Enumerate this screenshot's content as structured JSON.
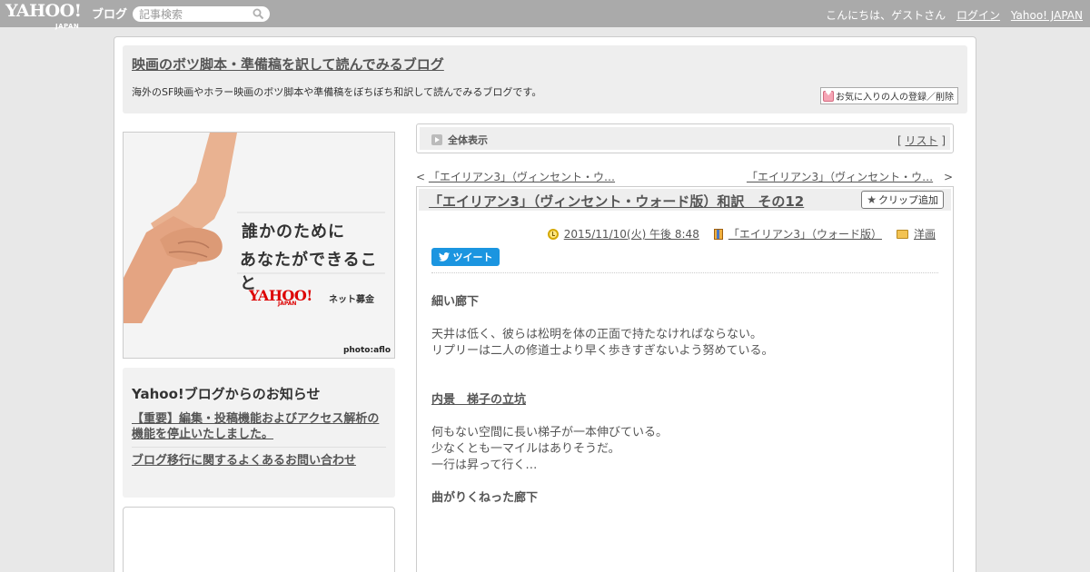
{
  "topbar": {
    "logo": "YAHOO!",
    "logo_sub": "JAPAN",
    "logo_blog": "ブログ",
    "search_placeholder": "記事検索",
    "greeting": "こんにちは、ゲストさん",
    "login": "ログイン",
    "yahoo_japan": "Yahoo! JAPAN"
  },
  "header": {
    "title": "映画のボツ脚本・準備稿を訳して読んでみるブログ",
    "description": "海外のSF映画やホラー映画のボツ脚本や準備稿をぼちぼち和訳して読んでみるブログです。",
    "fav_button": "お気に入りの人の登録／削除"
  },
  "banner": {
    "line1": "誰かのために",
    "line2": "あなたができること",
    "brand": "YAHOO!",
    "brand_sub": "JAPAN",
    "bokin": "ネット募金",
    "credit": "photo:aflo"
  },
  "notice": {
    "title": "Yahoo!ブログからのお知らせ",
    "links": [
      "【重要】編集・投稿機能およびアクセス解析の機能を停止いたしました。",
      "ブログ移行に関するよくあるお問い合わせ"
    ]
  },
  "viewbar": {
    "label": "全体表示",
    "list_open": "[",
    "list": "リスト",
    "list_close": "]"
  },
  "nav": {
    "prev_arrow": "<",
    "prev": "「エイリアン3」（ヴィンセント・ウ…",
    "next": "「エイリアン3」（ヴィンセント・ウ…",
    "next_arrow": ">"
  },
  "article": {
    "title": "「エイリアン3」（ヴィンセント・ウォード版）和訳　その12",
    "clip_button": "クリップ追加",
    "date": "2015/11/10(火) 午後 8:48",
    "category": "「エイリアン3」（ウォード版）",
    "folder": "洋画",
    "tweet": "ツイート",
    "heading1": "細い廊下",
    "para1": [
      "天井は低く、彼らは松明を体の正面で持たなければならない。",
      "リプリーは二人の修道士より早く歩きすぎないよう努めている。"
    ],
    "heading2": "内景　梯子の立坑",
    "para2": [
      "何もない空間に長い梯子が一本伸びている。",
      "少なくとも一マイルはありそうだ。",
      "一行は昇って行く…"
    ],
    "heading3": "曲がりくねった廊下"
  }
}
